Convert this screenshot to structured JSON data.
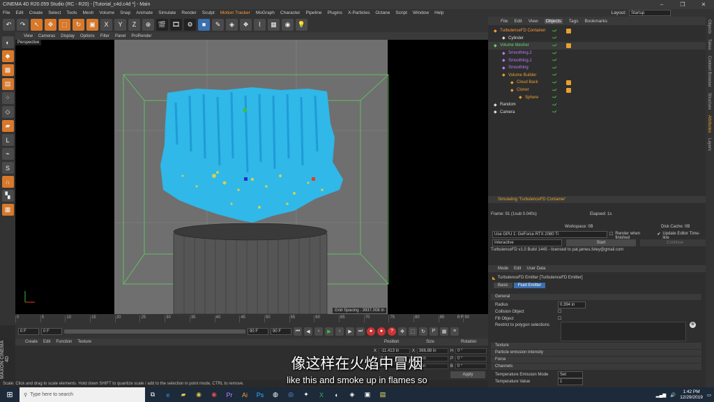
{
  "window": {
    "title": "CINEMA 4D R20.059 Studio (RC - R20) - [Tutorial_c4d.c4d *] - Main"
  },
  "menubar": {
    "items": [
      "File",
      "Edit",
      "Create",
      "Select",
      "Tools",
      "Mesh",
      "Volume",
      "Snap",
      "Animate",
      "Simulate",
      "Render",
      "Sculpt",
      "Motion Tracker",
      "MoGraph",
      "Character",
      "Pipeline",
      "Plugins",
      "X-Particles",
      "Octane",
      "Script",
      "Window",
      "Help"
    ],
    "layout_label": "Layout:",
    "layout_value": "Startup"
  },
  "viewport": {
    "menu": [
      "View",
      "Cameras",
      "Display",
      "Options",
      "Filter",
      "Panel",
      "ProRender"
    ],
    "label": "Perspective",
    "grid_spacing": "Grid Spacing : 3937.008 in"
  },
  "timeline": {
    "ticks": [
      "0",
      "5",
      "10",
      "15",
      "20",
      "25",
      "30",
      "35",
      "40",
      "45",
      "50",
      "55",
      "60",
      "65",
      "70",
      "75",
      "80",
      "85",
      "90"
    ],
    "current_frame": "0 F",
    "start_frame": "0 F",
    "end_frame": "90 F",
    "end_frame_2": "90 F",
    "frame_readout": "0 F"
  },
  "material_panel": {
    "menu": [
      "Create",
      "Edit",
      "Function",
      "Texture"
    ],
    "brand": "MAXON CINEMA 4D"
  },
  "coordinates": {
    "headers": [
      "Position",
      "Size",
      "Rotation"
    ],
    "rows": [
      {
        "axis": "X",
        "pos": "-11.413 in",
        "axis2": "X",
        "size": "366.88 in",
        "rot_axis": "H",
        "rot": "0 °"
      },
      {
        "axis": "Y",
        "pos": "0 in",
        "axis2": "Y",
        "size": "0 in",
        "rot_axis": "P",
        "rot": "0 °"
      },
      {
        "axis": "Z",
        "pos": "0 in",
        "axis2": "Z",
        "size": "0 in",
        "rot_axis": "B",
        "rot": "0 °"
      }
    ],
    "apply_label": "Apply"
  },
  "statusbar": {
    "text": "Scale: Click and drag to scale elements. Hold down SHIFT to quantize scale / add to the selection in point mode, CTRL to remove."
  },
  "objects": {
    "menu": [
      "File",
      "Edit",
      "View",
      "Objects",
      "Tags",
      "Bookmarks"
    ],
    "active_tab": "Objects",
    "items": [
      {
        "name": "TurbulenceFD Container",
        "color": "#ff9a3c"
      },
      {
        "name": "Cylinder",
        "color": "#ddd"
      },
      {
        "name": "Volume Mesher",
        "color": "#6fd36f"
      },
      {
        "name": "Smoothing.2",
        "color": "#b87bff"
      },
      {
        "name": "Smoothing.1",
        "color": "#b87bff"
      },
      {
        "name": "Smoothing",
        "color": "#b87bff"
      },
      {
        "name": "Volume Builder",
        "color": "#e8a030"
      },
      {
        "name": "Cloud Back",
        "color": "#e8a030"
      },
      {
        "name": "Cloner",
        "color": "#e8a030"
      },
      {
        "name": "Sphere",
        "color": "#e8a030"
      },
      {
        "name": "Random",
        "color": "#ddd"
      },
      {
        "name": "Camera",
        "color": "#ddd"
      }
    ]
  },
  "simulation": {
    "header": "Simulating 'TurbulenceFD Container'",
    "frame": "Frame: 91 (1sub 0.040s)",
    "elapsed": "Elapsed: 1s",
    "workspace": "Workspace: 0B",
    "disk_cache": "Disk Cache: 0B",
    "gpu": "Use GPU 1: GeForce RTX 2080 Ti",
    "render_when_finished": "Render when finished",
    "update_editor": "Update Editor Time-line",
    "mode": "Interactive",
    "start_label": "Start",
    "continue_label": "Continue",
    "build_info": "TurbulenceFD v1.0 Build 1445 - licensed to pat.james.foley@gmail.com"
  },
  "attributes": {
    "menu": [
      "Mode",
      "Edit",
      "User Data"
    ],
    "object_title": "TurbulenceFD Emitter [TurbulenceFD Emitter]",
    "tabs": [
      "Basic",
      "Fluid Emitter"
    ],
    "active_tab": "Fluid Emitter",
    "section_general": "General",
    "radius_label": "Radius",
    "radius_value": "0.394 in",
    "collision_label": "Collision Object",
    "fill_label": "Fill Object",
    "restrict_label": "Restrict to polygon selections",
    "sections": [
      "Texture",
      "Particle emission intensity",
      "Force",
      "Channels"
    ],
    "temp_mode_label": "Temperature Emission Mode",
    "temp_mode_value": "Set",
    "temp_value_label": "Temperature Value",
    "temp_value": "1"
  },
  "right_strip": [
    "Objects",
    "Takes",
    "Content Browser",
    "Structure",
    "Attributes",
    "Layers"
  ],
  "subtitles": {
    "chinese": "像这样在火焰中冒烟",
    "english": "like this and smoke up in flames so"
  },
  "taskbar": {
    "search_placeholder": "Type here to search",
    "time": "1:42 PM",
    "date": "12/29/2019"
  }
}
